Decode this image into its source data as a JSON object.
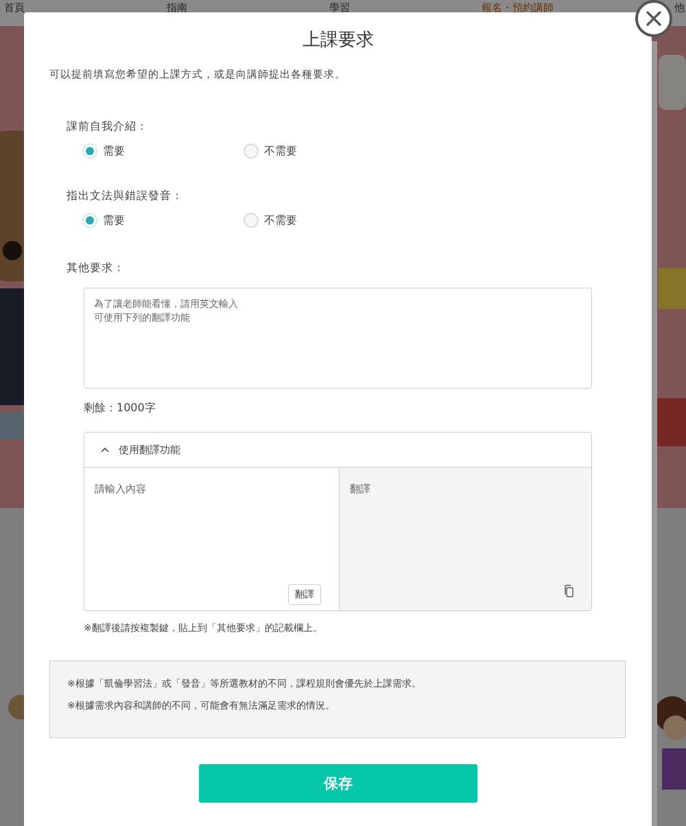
{
  "nav": [
    {
      "label": "首頁",
      "selected": false
    },
    {
      "label": "指南",
      "selected": false
    },
    {
      "label": "學習",
      "selected": false
    },
    {
      "label": "報名・預約講師",
      "selected": true
    },
    {
      "label": "他",
      "selected": false
    }
  ],
  "modal": {
    "title": "上課要求",
    "intro": "可以提前填寫您希望的上課方式，或是向講師提出各種要求。",
    "questions": [
      {
        "label": "課前自我介紹：",
        "options": [
          {
            "label": "需要",
            "selected": true
          },
          {
            "label": "不需要",
            "selected": false
          }
        ]
      },
      {
        "label": "指出文法與錯誤發音：",
        "options": [
          {
            "label": "需要",
            "selected": true
          },
          {
            "label": "不需要",
            "selected": false
          }
        ]
      }
    ],
    "other_label": "其他要求：",
    "other_field": {
      "placeholder": "為了讓老師能看懂，請用英文輸入可使用下列的翻譯功能"
    },
    "remaining": "剩餘：1000字",
    "translator": {
      "header": "使用翻譯功能",
      "expanded": true,
      "input": {
        "placeholder": "請輸入內容"
      },
      "button": "翻譯",
      "output": {
        "placeholder": "翻譯"
      }
    },
    "translator_note": "※翻譯後請按複製鍵，貼上到「其他要求」的記載欄上。",
    "notices": [
      "※根據「凱倫學習法」或「發音」等所選教材的不同，課程規則會優先於上課需求。",
      "※根據需求內容和講師的不同，可能會有無法滿足需求的情況。"
    ],
    "save_button": "保存"
  }
}
